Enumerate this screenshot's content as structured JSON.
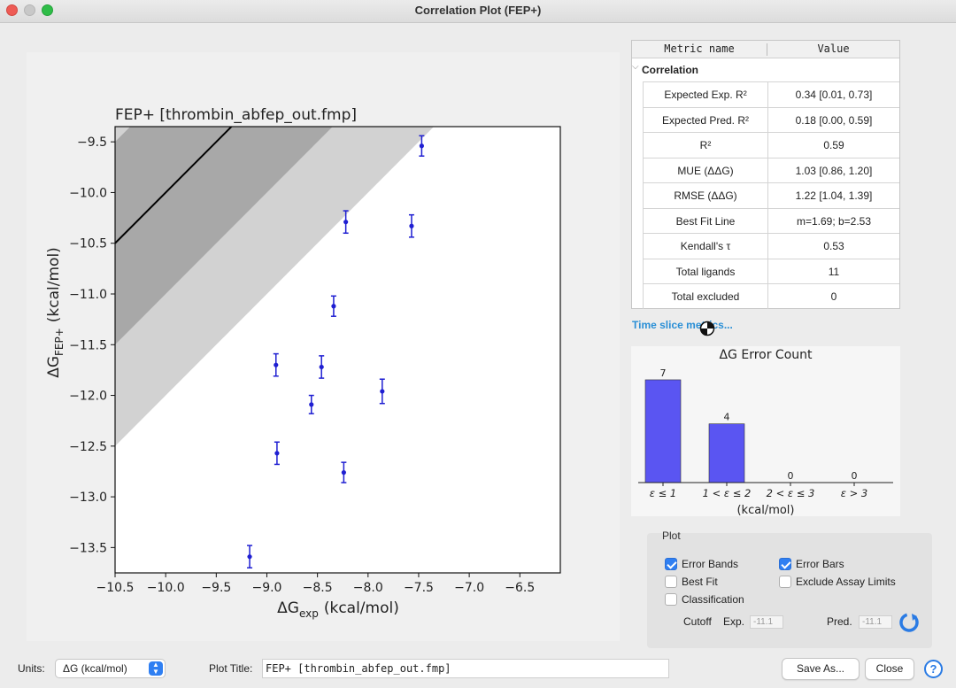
{
  "window": {
    "title": "Correlation Plot (FEP+)"
  },
  "chart_data": [
    {
      "type": "scatter",
      "title": "FEP+ [thrombin_abfep_out.fmp]",
      "xlabel_main": "ΔG",
      "xlabel_sub": "exp",
      "xlabel_unit": "(kcal/mol)",
      "ylabel_main": "ΔG",
      "ylabel_sub": "FEP+",
      "ylabel_unit": "(kcal/mol)",
      "xlim": [
        -10.5,
        -6.1
      ],
      "ylim": [
        -13.75,
        -9.35
      ],
      "xticks": [
        -10.5,
        -10.0,
        -9.5,
        -9.0,
        -8.5,
        -8.0,
        -7.5,
        -7.0,
        -6.5
      ],
      "yticks": [
        -9.5,
        -10.0,
        -10.5,
        -11.0,
        -11.5,
        -12.0,
        -12.5,
        -13.0,
        -13.5
      ],
      "xtick_labels": [
        "−10.5",
        "−10.0",
        "−9.5",
        "−9.0",
        "−8.5",
        "−8.0",
        "−7.5",
        "−7.0",
        "−6.5"
      ],
      "ytick_labels": [
        "−9.5",
        "−10.0",
        "−10.5",
        "−11.0",
        "−11.5",
        "−12.0",
        "−12.5",
        "−13.0",
        "−13.5"
      ],
      "error_bands": [
        1.0,
        2.0
      ],
      "points": [
        {
          "x": -9.17,
          "y": -13.59,
          "err": 0.11
        },
        {
          "x": -8.9,
          "y": -12.57,
          "err": 0.11
        },
        {
          "x": -8.91,
          "y": -11.7,
          "err": 0.11
        },
        {
          "x": -8.56,
          "y": -12.09,
          "err": 0.09
        },
        {
          "x": -8.46,
          "y": -11.72,
          "err": 0.11
        },
        {
          "x": -8.34,
          "y": -11.12,
          "err": 0.1
        },
        {
          "x": -8.24,
          "y": -12.76,
          "err": 0.1
        },
        {
          "x": -8.22,
          "y": -10.29,
          "err": 0.11
        },
        {
          "x": -7.86,
          "y": -11.96,
          "err": 0.12
        },
        {
          "x": -7.57,
          "y": -10.33,
          "err": 0.11
        },
        {
          "x": -7.47,
          "y": -9.54,
          "err": 0.1
        }
      ],
      "colors": {
        "points": "#1f1fd2",
        "inner_band": "#a8a8a8",
        "outer_band": "#d2d2d2",
        "background": "#ffffff",
        "fit_line": "#000000"
      }
    },
    {
      "type": "bar",
      "title": "ΔG Error Count",
      "xlabel": "(kcal/mol)",
      "categories": [
        "ε ≤ 1",
        "1 < ε ≤ 2",
        "2 < ε ≤ 3",
        "ε > 3"
      ],
      "values": [
        7,
        4,
        0,
        0
      ],
      "ylim": [
        0,
        7.6
      ],
      "colors": {
        "bars": "#5a55f2"
      }
    }
  ],
  "metrics": {
    "col_name": "Metric name",
    "col_value": "Value",
    "group": "Correlation",
    "rows": [
      {
        "name": "Expected Exp. R²",
        "value": "0.34 [0.01, 0.73]"
      },
      {
        "name": "Expected Pred. R²",
        "value": "0.18 [0.00, 0.59]"
      },
      {
        "name": "R²",
        "value": "0.59"
      },
      {
        "name": "MUE (ΔΔG)",
        "value": "1.03 [0.86, 1.20]"
      },
      {
        "name": "RMSE (ΔΔG)",
        "value": "1.22 [1.04, 1.39]"
      },
      {
        "name": "Best Fit Line",
        "value": "m=1.69; b=2.53"
      },
      {
        "name": "Kendall's τ",
        "value": "0.53"
      },
      {
        "name": "Total ligands",
        "value": "11"
      },
      {
        "name": "Total excluded",
        "value": "0"
      }
    ]
  },
  "time_slice_link": "Time slice metrics...",
  "plot_options": {
    "group_title": "Plot",
    "error_bands": {
      "label": "Error Bands",
      "checked": true
    },
    "error_bars": {
      "label": "Error Bars",
      "checked": true
    },
    "best_fit": {
      "label": "Best Fit",
      "checked": false
    },
    "exclude_assay": {
      "label": "Exclude Assay Limits",
      "checked": false
    },
    "classification": {
      "label": "Classification",
      "checked": false
    },
    "cutoff_label": "Cutoff",
    "exp_label": "Exp.",
    "exp_value": "-11.1",
    "pred_label": "Pred.",
    "pred_value": "-11.1"
  },
  "bottom": {
    "units_label": "Units:",
    "units_value": "ΔG (kcal/mol)",
    "plot_title_label": "Plot Title:",
    "plot_title_value": "FEP+ [thrombin_abfep_out.fmp]",
    "save_as": "Save As...",
    "close": "Close",
    "help": "?"
  }
}
